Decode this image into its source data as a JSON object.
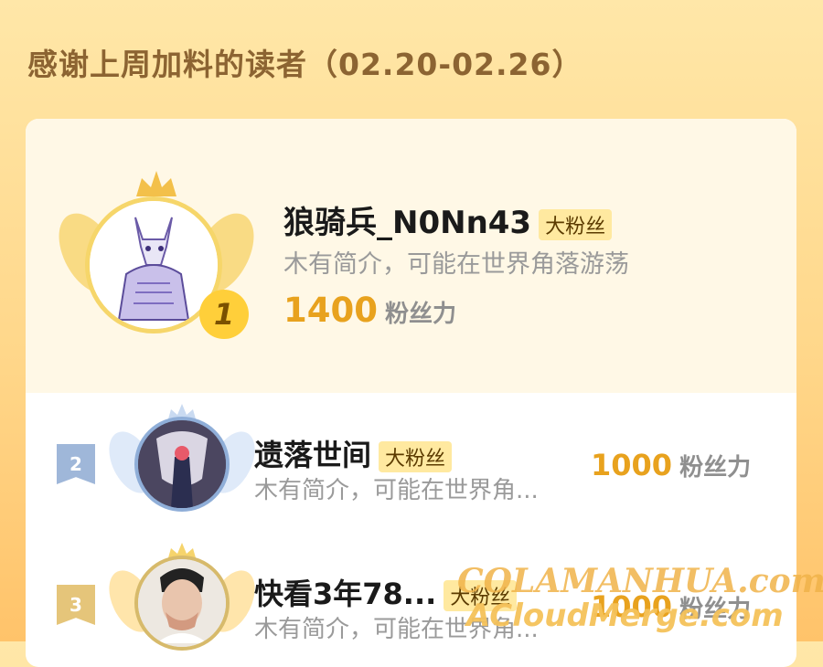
{
  "header": {
    "title": "感谢上周加料的读者（02.20-02.26）"
  },
  "ranking": [
    {
      "rank": "1",
      "name": "狼骑兵_N0Nn43",
      "tag": "大粉丝",
      "desc": "木有简介，可能在世界角落游荡",
      "score": "1400",
      "unit": "粉丝力"
    },
    {
      "rank": "2",
      "name": "遗落世间",
      "tag": "大粉丝",
      "desc": "木有简介，可能在世界角...",
      "score": "1000",
      "unit": "粉丝力"
    },
    {
      "rank": "3",
      "name": "快看3年78...",
      "tag": "大粉丝",
      "desc": "木有简介，可能在世界角...",
      "score": "1000",
      "unit": "粉丝力"
    }
  ],
  "watermarks": {
    "line1": "COLAMANHUA.com",
    "line2": "ACloudMerge.com"
  },
  "colors": {
    "accent": "#E8A21E",
    "title": "#8C6432",
    "badge": "#FFE9A0"
  }
}
